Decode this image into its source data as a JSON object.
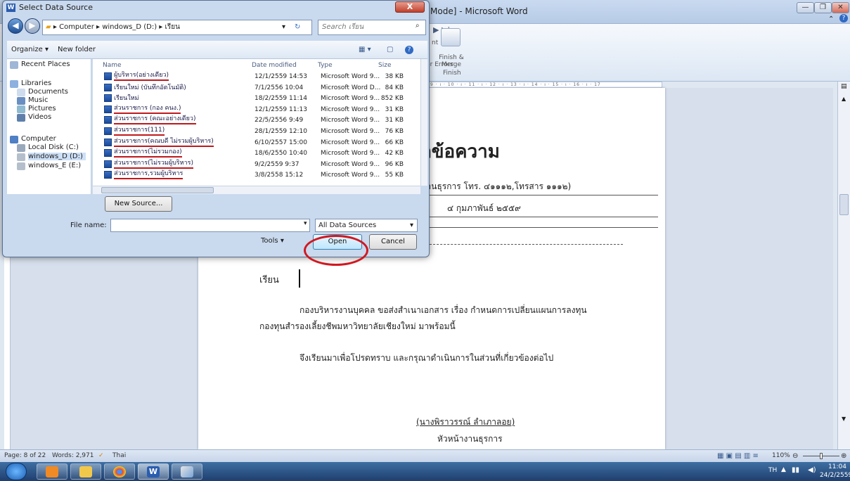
{
  "word": {
    "title": "Mode] - Microsoft Word",
    "ribbon": {
      "finish_merge_label": "Finish & Merge",
      "finish_group_label": "Finish",
      "errors_label": "for Errors",
      "nt_label": "nt"
    },
    "ruler_text": "8 · ı · 9 · ı · 10 · ı · 11 · ı · 12 · ı · 13 · ı · 14 · ı · 15 · ı · 16 · ı · 17",
    "document": {
      "heading": "กข้อความ",
      "line1": "(งานธุรการ โทร. ๔๑๑๑๒,โทรสาร ๑๑๑๒)",
      "line2": "๔  กุมภาพันธ์  ๒๕๕๙",
      "dear_label": "เรียน",
      "body1": "กองบริหารงานบุคคล  ขอส่งสำเนาเอกสาร  เรื่อง  กำหนดการเปลี่ยนแผนการลงทุน",
      "body2": "กองทุนสำรองเลี้ยงชีพมหาวิทยาลัยเชียงใหม่ มาพร้อมนี้",
      "body3": "จึงเรียนมาเพื่อโปรดทราบ  และกรุณาดำเนินการในส่วนที่เกี่ยวข้องต่อไป",
      "signature": "(นางพิราวรรณ์  ลำเภาลอย)",
      "position": "หัวหน้างานธุรการ"
    },
    "status": {
      "page": "Page: 8 of 22",
      "words": "Words: 2,971",
      "language": "Thai",
      "zoom": "110%"
    }
  },
  "taskbar": {
    "lang": "TH",
    "time": "11:04",
    "date": "24/2/2559"
  },
  "dialog": {
    "title": "Select Data Source",
    "close_label": "X",
    "address": {
      "crumb1": "Computer",
      "crumb2": "windows_D (D:)",
      "crumb3": "เรียน"
    },
    "search_placeholder": "Search เรียน",
    "toolbar": {
      "organize": "Organize ▾",
      "new_folder": "New folder"
    },
    "nav": {
      "recent": "Recent Places",
      "libraries": "Libraries",
      "documents": "Documents",
      "music": "Music",
      "pictures": "Pictures",
      "videos": "Videos",
      "computer": "Computer",
      "local_c": "Local Disk (C:)",
      "windows_d": "windows_D (D:)",
      "windows_e": "windows_E (E:)"
    },
    "columns": {
      "name": "Name",
      "date": "Date modified",
      "type": "Type",
      "size": "Size"
    },
    "files": [
      {
        "name": "ผู้บริหาร(อย่างเดียว)",
        "date": "12/1/2559 14:53",
        "type": "Microsoft Word 9...",
        "size": "38 KB"
      },
      {
        "name": "เรียนใหม่ (บันทึกอัตโนมัติ)",
        "date": "7/1/2556 10:04",
        "type": "Microsoft Word D...",
        "size": "84 KB"
      },
      {
        "name": "เรียนใหม่",
        "date": "18/2/2559 11:14",
        "type": "Microsoft Word 9...",
        "size": "852 KB"
      },
      {
        "name": "ส่วนราชการ (กอง คนง.)",
        "date": "12/1/2559 11:13",
        "type": "Microsoft Word 9...",
        "size": "31 KB"
      },
      {
        "name": "ส่วนราชการ (คณะอย่างเดียว)",
        "date": "22/5/2556 9:49",
        "type": "Microsoft Word 9...",
        "size": "31 KB"
      },
      {
        "name": "ส่วนราชการ(111)",
        "date": "28/1/2559 12:10",
        "type": "Microsoft Word 9...",
        "size": "76 KB"
      },
      {
        "name": "ส่วนราชการ(คณบดี ไม่รวมผู้บริหาร)",
        "date": "6/10/2557 15:00",
        "type": "Microsoft Word 9...",
        "size": "66 KB"
      },
      {
        "name": "ส่วนราชการ(ไม่รวมกอง)",
        "date": "18/6/2550 10:40",
        "type": "Microsoft Word 9...",
        "size": "42 KB"
      },
      {
        "name": "ส่วนราชการ(ไม่รวมผู้บริหาร)",
        "date": "9/2/2559 9:37",
        "type": "Microsoft Word 9...",
        "size": "96 KB"
      },
      {
        "name": "ส่วนราชการ,รวมผู้บริหาร",
        "date": "3/8/2558 15:12",
        "type": "Microsoft Word 9...",
        "size": "55 KB"
      }
    ],
    "new_source_label": "New Source...",
    "file_name_label": "File name:",
    "file_name_value": "",
    "filter_value": "All Data Sources",
    "tools_label": "Tools",
    "open_label": "Open",
    "cancel_label": "Cancel",
    "colors": {
      "highlight": "#c0181c"
    }
  }
}
